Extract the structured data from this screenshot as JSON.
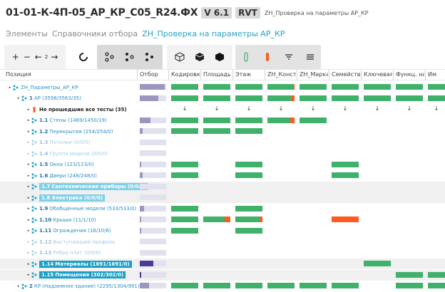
{
  "header": {
    "title": "01-01-К-4П-05_АР_КР_С05_R24.ФХ",
    "version": "V 6.1",
    "format": "RVT",
    "subtitle": "ZH_Проверка на параметры АР_КР"
  },
  "tabs": [
    {
      "label": "Элементы",
      "active": false
    },
    {
      "label": "Справочники отбора",
      "active": false
    },
    {
      "label": "ZH_Проверка на параметры АР_КР",
      "active": true
    }
  ],
  "toolbar": {
    "level_value": "2",
    "icons": [
      "plus-icon",
      "minus-icon",
      "arrow-left-icon",
      "arrow-right-icon",
      "ring-icon",
      "tree-one-icon",
      "tree-two-icon",
      "tree-three-icon",
      "cube-outline-icon",
      "cube-half-icon",
      "cube-solid-icon",
      "flask-outline-icon",
      "flask-red-icon",
      "filter-icon",
      "list-icon"
    ]
  },
  "columns": [
    "Позиция",
    "Отбор",
    "Кодировка",
    "Площадь",
    "Этаж",
    "ZH_Констр",
    "ZH_Марка",
    "Семейство",
    "Ключевая г",
    "Функц. наз",
    "Им"
  ],
  "colors": {
    "accent": "#26a3c4",
    "ok": "#3fb16a",
    "fail": "#ff5a1f",
    "selection": "#9b95c0"
  },
  "rows": [
    {
      "num": "",
      "label": "ZH_Параметры_АР_КР",
      "sel": 0.95,
      "cells": [
        0.97,
        1,
        1,
        0.97,
        1,
        1,
        1,
        1,
        1
      ],
      "arrows": false,
      "hl": false
    },
    {
      "num": "1",
      "label": "АР",
      "count": "(3598/3563/35)",
      "sel": 0.7,
      "cells": [
        0.97,
        1,
        1,
        0.87,
        1,
        1,
        1,
        1,
        1
      ],
      "arrows": false,
      "hl": false
    },
    {
      "num": "",
      "label": "Не прошедшие все тесты (35)",
      "sel": 0,
      "cells": [],
      "arrows": true,
      "hl": false
    },
    {
      "num": "1.1",
      "label": "Стены (1469/1450/19)",
      "sel": 0.4,
      "cells": [
        1,
        1,
        1,
        0.85,
        1,
        null,
        null,
        null,
        null
      ],
      "arrows": false,
      "hl": false
    },
    {
      "num": "1.2",
      "label": "Перекрытия (254/254/0)",
      "sel": 0.1,
      "cells": [
        1,
        1,
        1,
        null,
        null,
        null,
        null,
        null,
        null
      ],
      "arrows": false,
      "hl": false
    },
    {
      "num": "1.3",
      "label": "Потолки (0/0/0)",
      "sel": 0,
      "cells": [],
      "arrows": false,
      "hl": false,
      "faded": true
    },
    {
      "num": "1.4",
      "label": "Группа модели (0/0/0)",
      "sel": 0,
      "cells": [],
      "arrows": false,
      "hl": false,
      "faded": true
    },
    {
      "num": "1.5",
      "label": "Окна (123/123/0)",
      "sel": 0.05,
      "cells": [
        1,
        null,
        1,
        null,
        null,
        1,
        null,
        null,
        null
      ],
      "arrows": false,
      "hl": false
    },
    {
      "num": "1.6",
      "label": "Двери (248/248/0)",
      "sel": 0.1,
      "cells": [
        1,
        null,
        1,
        null,
        null,
        1,
        null,
        null,
        null
      ],
      "arrows": false,
      "hl": false
    },
    {
      "num": "1.7",
      "label": "Сантехнические приборы (0/0/0)",
      "sel": 0,
      "cells": [],
      "arrows": false,
      "hl": true,
      "chip": "light"
    },
    {
      "num": "1.8",
      "label": "Электрика (0/0/0)",
      "sel": 0,
      "cells": [],
      "arrows": false,
      "hl": true,
      "chip": "light"
    },
    {
      "num": "1.9",
      "label": "Обобщенные модели (533/533/0)",
      "sel": 0.15,
      "cells": [
        1,
        null,
        1,
        null,
        null,
        null,
        null,
        null,
        null
      ],
      "arrows": false,
      "hl": false
    },
    {
      "num": "1.10",
      "label": "Крыши (11/1/10)",
      "sel": 0.05,
      "cells": [
        1,
        0.8,
        0.9,
        null,
        null,
        -1,
        null,
        null,
        null
      ],
      "arrows": false,
      "hl": false
    },
    {
      "num": "1.11",
      "label": "Ограждения (16/10/6)",
      "sel": 0.05,
      "cells": [
        1,
        null,
        1,
        null,
        null,
        null,
        null,
        null,
        null
      ],
      "arrows": false,
      "hl": false
    },
    {
      "num": "1.12",
      "label": "Выступающий профиль",
      "sel": 0,
      "cells": [],
      "arrows": false,
      "hl": false,
      "faded": true
    },
    {
      "num": "1.13",
      "label": "Ребра плит (0/0/0)",
      "sel": 0,
      "cells": [],
      "arrows": false,
      "hl": false,
      "faded": true
    },
    {
      "num": "1.14",
      "label": "Материалы (1691/1691/0)",
      "sel": 0.5,
      "sel_dark": true,
      "cells": [
        null,
        null,
        null,
        null,
        null,
        null,
        1,
        null,
        null
      ],
      "arrows": false,
      "hl": true,
      "chip": "dark"
    },
    {
      "num": "1.15",
      "label": "Помещения (302/302/0)",
      "sel": 0.05,
      "sel_dark": true,
      "cells": [
        null,
        null,
        null,
        null,
        null,
        null,
        null,
        1,
        1
      ],
      "arrows": false,
      "hl": true,
      "chip": "dark"
    },
    {
      "num": "2",
      "label": "КР (Надземное здание)",
      "count": "(2295/1304/991)",
      "sel": 0.35,
      "cells": [
        1,
        1,
        1,
        1,
        1,
        1,
        null,
        1,
        1
      ],
      "arrows": false,
      "hl": false
    }
  ]
}
